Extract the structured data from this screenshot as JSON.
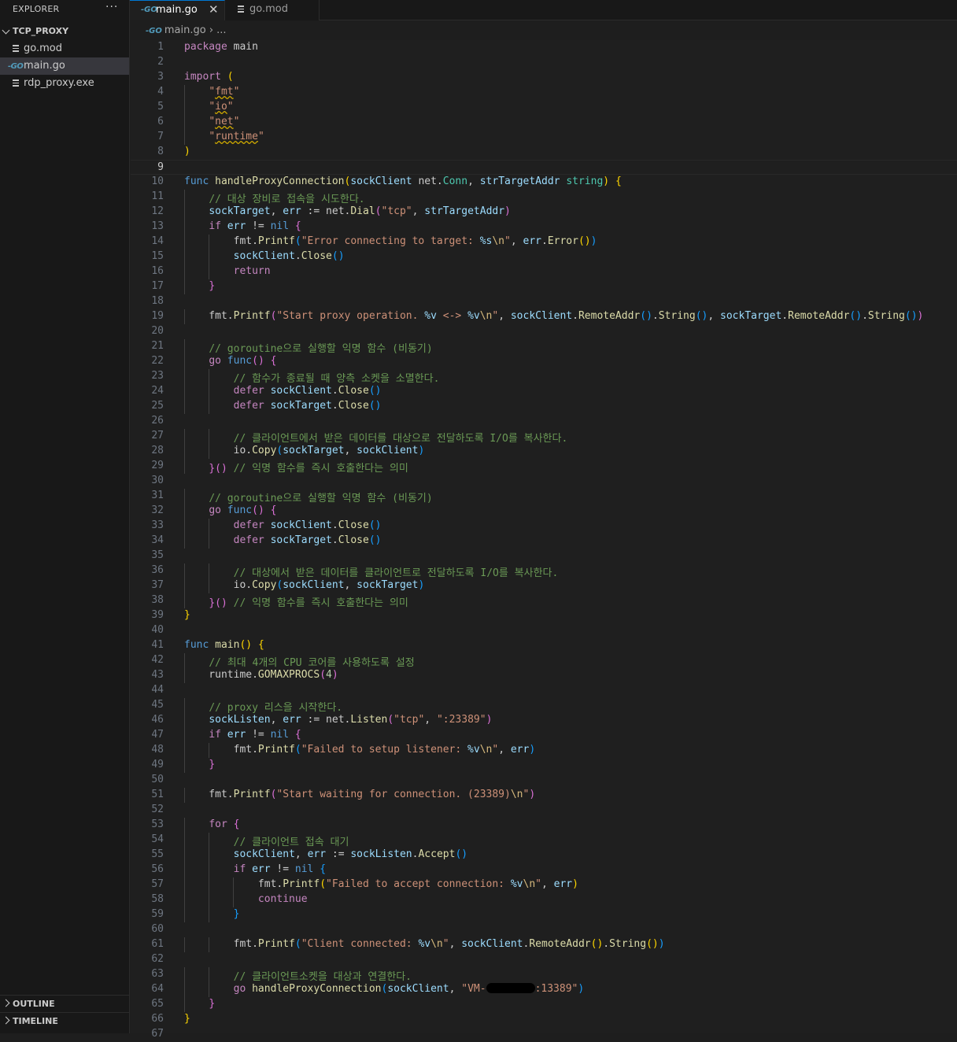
{
  "sidebar": {
    "title": "EXPLORER",
    "more_label": "···",
    "folder": "TCP_PROXY",
    "files": [
      "go.mod",
      "main.go",
      "rdp_proxy.exe"
    ],
    "outline": "OUTLINE",
    "timeline": "TIMELINE"
  },
  "tabs": [
    {
      "label": "main.go",
      "icon": "GO",
      "active": true
    },
    {
      "label": "go.mod",
      "active": false
    }
  ],
  "breadcrumb": {
    "file": "main.go",
    "separator": "›",
    "more": "..."
  },
  "editor": {
    "current_line": 9,
    "redacted": "VM-[redacted]:13389",
    "lines": [
      "package main",
      "",
      "import (",
      "    \"fmt\"",
      "    \"io\"",
      "    \"net\"",
      "    \"runtime\"",
      ")",
      "",
      "func handleProxyConnection(sockClient net.Conn, strTargetAddr string) {",
      "    // 대상 장비로 접속을 시도한다.",
      "    sockTarget, err := net.Dial(\"tcp\", strTargetAddr)",
      "    if err != nil {",
      "        fmt.Printf(\"Error connecting to target: %s\\n\", err.Error())",
      "        sockClient.Close()",
      "        return",
      "    }",
      "",
      "    fmt.Printf(\"Start proxy operation. %v <-> %v\\n\", sockClient.RemoteAddr().String(), sockTarget.RemoteAddr().String())",
      "",
      "    // goroutine으로 실행할 익명 함수 (비동기)",
      "    go func() {",
      "        // 함수가 종료될 때 양측 소켓을 소멸한다.",
      "        defer sockClient.Close()",
      "        defer sockTarget.Close()",
      "",
      "        // 클라이언트에서 받은 데이터를 대상으로 전달하도록 I/O를 복사한다.",
      "        io.Copy(sockTarget, sockClient)",
      "    }() // 익명 함수를 즉시 호출한다는 의미",
      "",
      "    // goroutine으로 실행할 익명 함수 (비동기)",
      "    go func() {",
      "        defer sockClient.Close()",
      "        defer sockTarget.Close()",
      "",
      "        // 대상에서 받은 데이터를 클라이언트로 전달하도록 I/O를 복사한다.",
      "        io.Copy(sockClient, sockTarget)",
      "    }() // 익명 함수를 즉시 호출한다는 의미",
      "}",
      "",
      "func main() {",
      "    // 최대 4개의 CPU 코어를 사용하도록 설정",
      "    runtime.GOMAXPROCS(4)",
      "",
      "    // proxy 리스을 시작한다.",
      "    sockListen, err := net.Listen(\"tcp\", \":23389\")",
      "    if err != nil {",
      "        fmt.Printf(\"Failed to setup listener: %v\\n\", err)",
      "    }",
      "",
      "    fmt.Printf(\"Start waiting for connection. (23389)\\n\")",
      "",
      "    for {",
      "        // 클라이언트 접속 대기",
      "        sockClient, err := sockListen.Accept()",
      "        if err != nil {",
      "            fmt.Printf(\"Failed to accept connection: %v\\n\", err)",
      "            continue",
      "        }",
      "",
      "        fmt.Printf(\"Client connected: %v\\n\", sockClient.RemoteAddr().String())",
      "",
      "        // 클라이언트소켓을 대상과 연결한다.",
      "        go handleProxyConnection(sockClient, \"VM-[redacted]:13389\")",
      "    }",
      "}",
      ""
    ]
  },
  "colors": {
    "keyword_blue": "#569cd6",
    "control_purple": "#c586c0",
    "function_yellow": "#dcdcaa",
    "string_orange": "#ce9178",
    "variable_lightblue": "#9cdcfe",
    "comment_green": "#6a9955",
    "number_green": "#b5cea8",
    "type_teal": "#4ec9b0",
    "accent": "#0078d4"
  }
}
